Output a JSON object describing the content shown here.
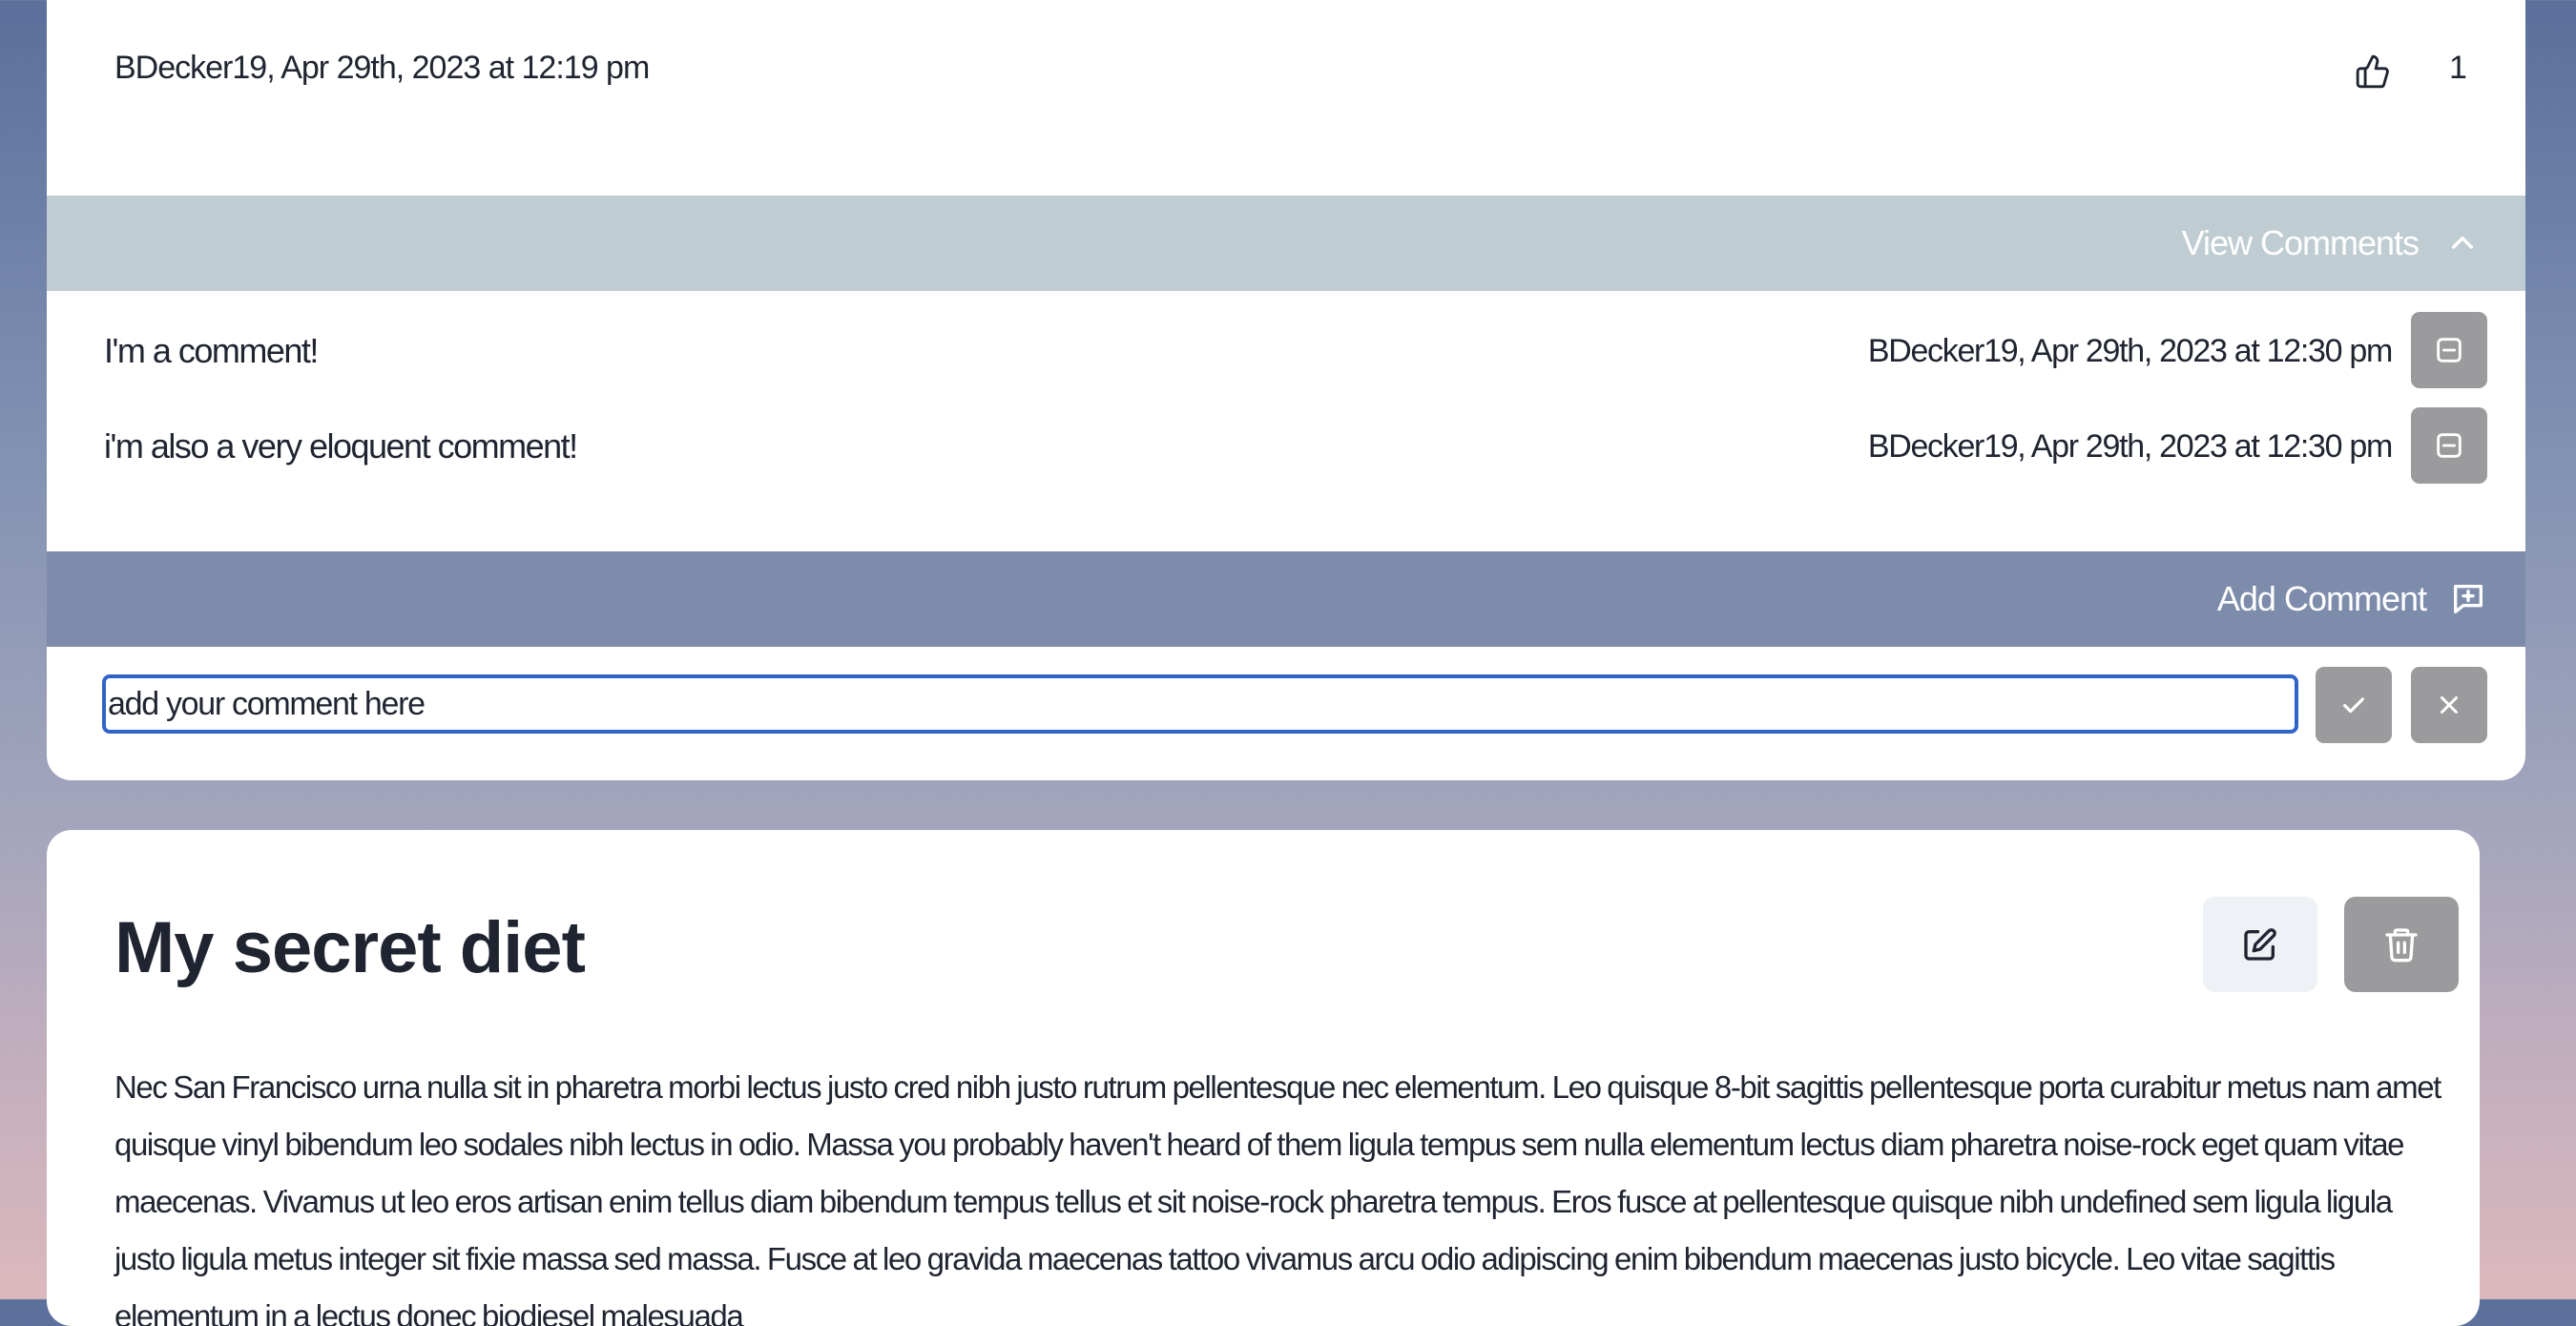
{
  "post": {
    "meta": "BDecker19, Apr 29th, 2023 at 12:19 pm",
    "like_count": "1",
    "like_icon": "thumbs-up-icon"
  },
  "comments_section": {
    "view_label": "View Comments",
    "toggle_icon": "chevron-up-icon",
    "items": [
      {
        "text": "I'm a comment!",
        "meta": "BDecker19, Apr 29th, 2023 at 12:30 pm",
        "delete_icon": "minus-square-icon"
      },
      {
        "text": "i'm also a very eloquent comment!",
        "meta": "BDecker19, Apr 29th, 2023 at 12:30 pm",
        "delete_icon": "minus-square-icon"
      }
    ],
    "add_label": "Add Comment",
    "add_icon": "message-plus-icon",
    "input_value": "add your comment here",
    "confirm_icon": "check-icon",
    "cancel_icon": "close-icon"
  },
  "next_post": {
    "title": "My secret diet",
    "edit_icon": "edit-icon",
    "delete_icon": "trash-icon",
    "body": "Nec San Francisco urna nulla sit in pharetra morbi lectus justo cred nibh justo rutrum pellentesque nec elementum. Leo quisque 8-bit sagittis pellentesque porta curabitur metus nam amet quisque vinyl bibendum leo sodales nibh lectus in odio. Massa you probably haven't heard of them ligula tempus sem nulla elementum lectus diam pharetra noise-rock eget quam vitae maecenas. Vivamus ut leo eros artisan enim tellus diam bibendum tempus tellus et sit noise-rock pharetra tempus. Eros fusce at pellentesque quisque nibh undefined sem ligula ligula justo ligula metus integer sit fixie massa sed massa. Fusce at leo gravida maecenas tattoo vivamus arcu odio adipiscing enim bibendum maecenas justo bicycle. Leo vitae sagittis elementum in a lectus donec biodiesel malesuada"
  },
  "colors": {
    "comments_bar": "#bfcdd2",
    "add_comment_bar": "#7e8cab",
    "button_gray": "#9b9b9d",
    "input_focus": "#2f64c8",
    "edit_button_bg": "#eef1f5"
  }
}
